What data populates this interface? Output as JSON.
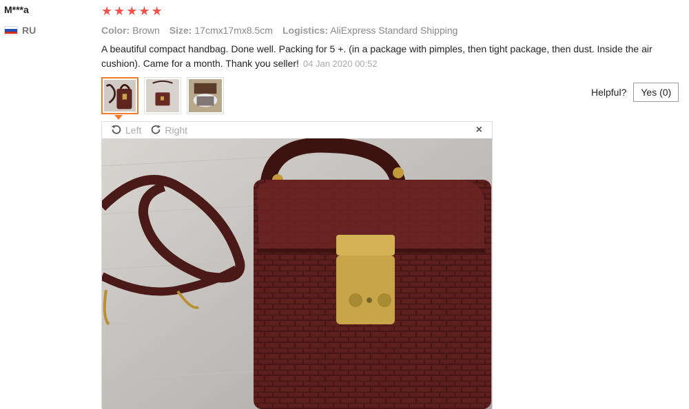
{
  "user": {
    "name": "M***a",
    "country": "RU",
    "flag_colors": [
      "#ffffff",
      "#1f4fb5",
      "#d52b1e"
    ]
  },
  "review": {
    "stars": [
      "★",
      "★",
      "★",
      "★",
      "★"
    ],
    "star_color": "#f4534b",
    "color_label": "Color:",
    "color_value": "Brown",
    "size_label": "Size:",
    "size_value": "17cmx17mx8.5cm",
    "logistics_label": "Logistics:",
    "logistics_value": "AliExpress Standard Shipping",
    "text": "A beautiful compact handbag. Done well. Packing for 5 +. (in a package with pimples, then tight package, then dust. Inside the air cushion). Came for a month. Thank you seller!",
    "date": "04 Jan 2020 00:52"
  },
  "thumbnails": [
    {
      "name": "thumb-1",
      "active": true
    },
    {
      "name": "thumb-2",
      "active": false
    },
    {
      "name": "thumb-3",
      "active": false
    }
  ],
  "helpful": {
    "label": "Helpful?",
    "yes_label": "Yes (0)"
  },
  "viewer": {
    "left_label": "Left",
    "right_label": "Right",
    "close_glyph": "×",
    "icons": [
      "rotate-left-icon",
      "rotate-right-icon",
      "close-icon"
    ]
  },
  "colors": {
    "accent": "#f07c2b",
    "muted": "#888888"
  }
}
